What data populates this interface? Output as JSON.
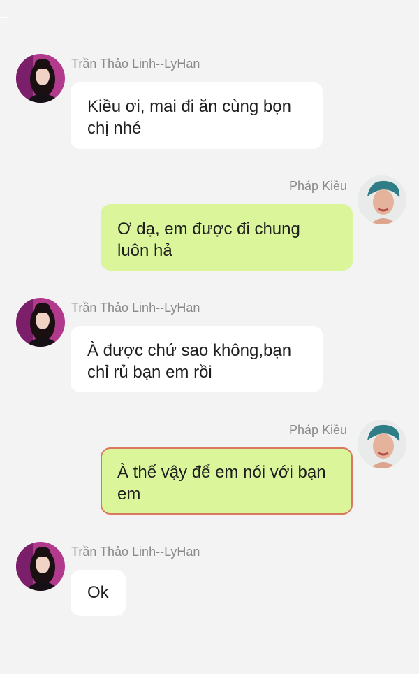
{
  "messages": [
    {
      "sender": "Trần Thảo Linh--LyHan",
      "side": "left",
      "text": "Kiều ơi, mai đi ăn cùng bọn\nchị nhé",
      "avatar": "female-avatar-icon"
    },
    {
      "sender": "Pháp Kiều",
      "side": "right",
      "text": "Ơ dạ, em được đi chung\nluôn hả",
      "avatar": "male-avatar-icon"
    },
    {
      "sender": "Trần Thảo Linh--LyHan",
      "side": "left",
      "text": "À được chứ sao không,bạn\nchỉ rủ bạn em rồi",
      "avatar": "female-avatar-icon"
    },
    {
      "sender": "Pháp Kiều",
      "side": "right",
      "text": "À thế vậy để em nói với bạn\nem",
      "avatar": "male-avatar-icon",
      "highlighted": true
    },
    {
      "sender": "Trần Thảo Linh--LyHan",
      "side": "left",
      "text": "Ok",
      "avatar": "female-avatar-icon"
    }
  ],
  "colors": {
    "background": "#f3f3f3",
    "incoming_bubble": "#ffffff",
    "outgoing_bubble": "#daf59a",
    "highlight_border": "#d9785e",
    "sender_name": "#8a8a8a"
  }
}
